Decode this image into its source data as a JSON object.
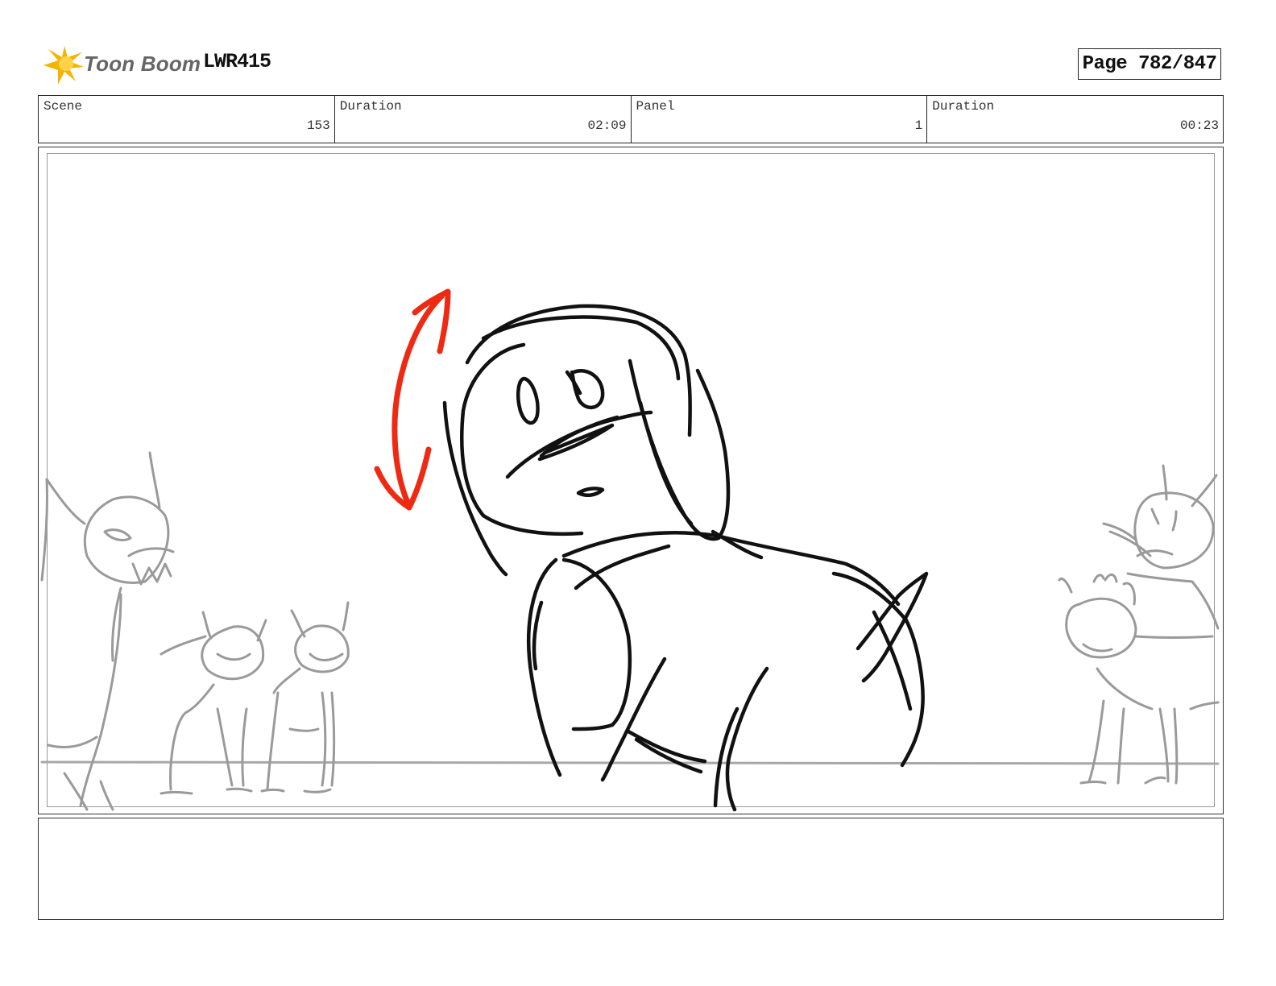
{
  "header": {
    "brand": "Toon Boom",
    "project_id": "LWR415",
    "page_label": "Page 782/847"
  },
  "info": {
    "scene_label": "Scene",
    "scene_value": "153",
    "scene_duration_label": "Duration",
    "scene_duration_value": "02:09",
    "panel_label": "Panel",
    "panel_value": "1",
    "panel_duration_label": "Duration",
    "panel_duration_value": "00:23"
  },
  "colors": {
    "logo_star": "#f5b400",
    "arrow": "#ee2a12",
    "ink": "#111111",
    "background_ink": "#9a9a9a"
  },
  "icons": {
    "logo": "toon-boom-star-icon",
    "motion_arrow": "double-headed-curved-arrow"
  },
  "notes": ""
}
